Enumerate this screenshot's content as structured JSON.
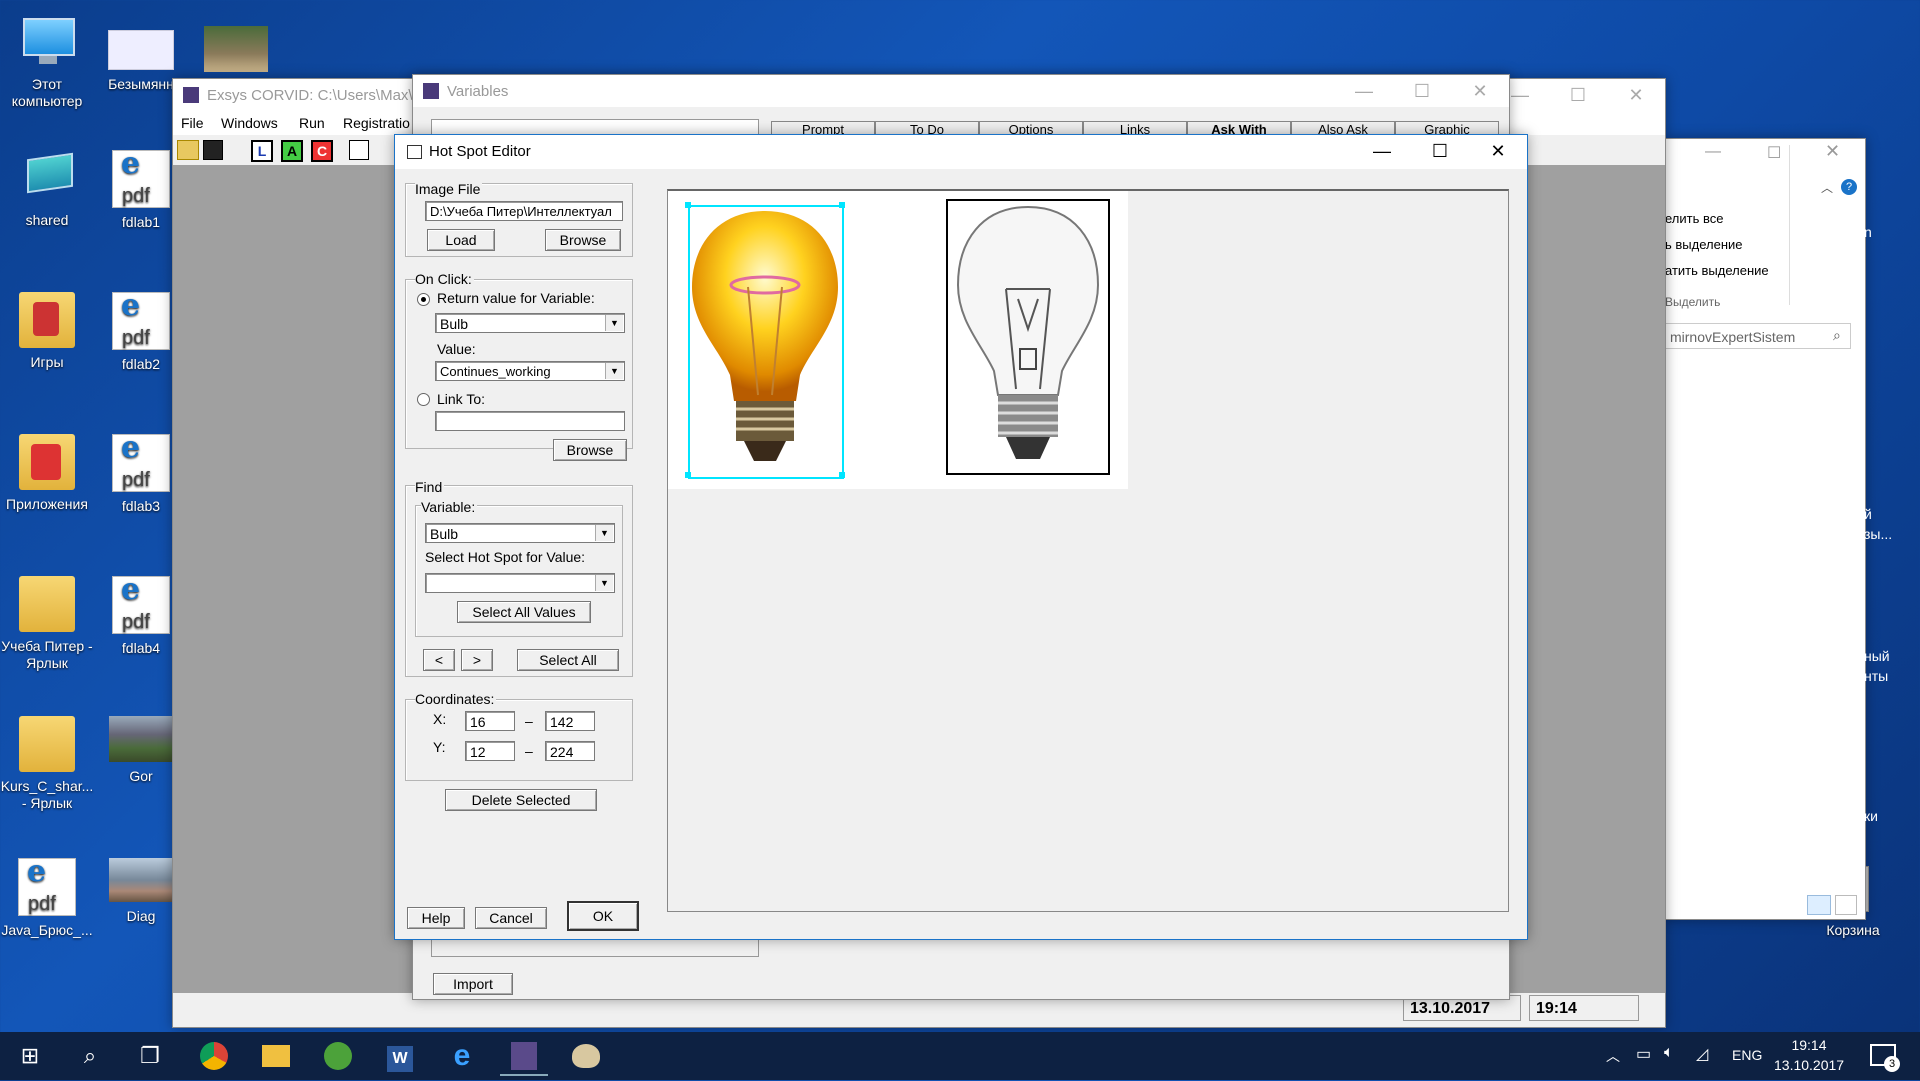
{
  "desktop": {
    "icons": [
      {
        "label": "Этот компьютер"
      },
      {
        "label": "Безымянн"
      },
      {
        "label": "shared"
      },
      {
        "label": "fdlab1"
      },
      {
        "label": "Игры"
      },
      {
        "label": "fdlab2"
      },
      {
        "label": "Приложения"
      },
      {
        "label": "fdlab3"
      },
      {
        "label": "Учеба Питер - Ярлык"
      },
      {
        "label": "fdlab4"
      },
      {
        "label": "Kurs_C_shar... - Ярлык"
      },
      {
        "label": "Gor"
      },
      {
        "label": "Java_Брюс_..."
      },
      {
        "label": "Diag"
      },
      {
        "label": "Корзина"
      }
    ]
  },
  "corvid_window": {
    "title": "Exsys CORVID: C:\\Users\\Max\\Co",
    "menu": [
      "File",
      "Windows",
      "Run",
      "Registratio"
    ],
    "status_date": "13.10.2017",
    "status_time": "19:14"
  },
  "variables_window": {
    "title": "Variables",
    "tabs": [
      "Prompt",
      "To Do",
      "Options",
      "Links",
      "Ask With",
      "Also Ask",
      "Graphic"
    ],
    "import_label": "Import"
  },
  "explorer_window": {
    "items": [
      "елить все",
      "ь выделение",
      "атить выделение",
      "Выделить"
    ],
    "search_text": "mirnovExpertSistem",
    "side_text": [
      "n",
      "й",
      "зы...",
      "ный",
      "нты",
      "ки"
    ]
  },
  "hot_spot_editor": {
    "title": "Hot Spot Editor",
    "image_file": {
      "group_label": "Image File",
      "path": "D:\\Учеба Питер\\Интеллектуал",
      "load_label": "Load",
      "browse_label": "Browse"
    },
    "on_click": {
      "group_label": "On Click:",
      "return_value_label": "Return value for Variable:",
      "return_value_selected": true,
      "variable_value": "Bulb",
      "value_label": "Value:",
      "value_value": "Continues_working",
      "link_to_label": "Link To:",
      "link_to_value": "",
      "browse_label": "Browse"
    },
    "find": {
      "group_label": "Find",
      "variable_label": "Variable:",
      "variable_value": "Bulb",
      "select_hotspot_label": "Select Hot Spot for Value:",
      "select_hotspot_value": "",
      "select_all_values_label": "Select All Values",
      "prev_label": "<",
      "next_label": ">",
      "select_all_label": "Select All"
    },
    "coordinates": {
      "group_label": "Coordinates:",
      "x_label": "X:",
      "y_label": "Y:",
      "x1": "16",
      "x2": "142",
      "y1": "12",
      "y2": "224",
      "dash": "–"
    },
    "delete_selected_label": "Delete Selected",
    "help_label": "Help",
    "cancel_label": "Cancel",
    "ok_label": "OK"
  },
  "taskbar": {
    "lang": "ENG",
    "time": "19:14",
    "date": "13.10.2017",
    "notification_count": "3"
  },
  "colors": {
    "selection": "#00e5ff",
    "desktop": "#1356b8",
    "taskbar": "#0d2142"
  }
}
